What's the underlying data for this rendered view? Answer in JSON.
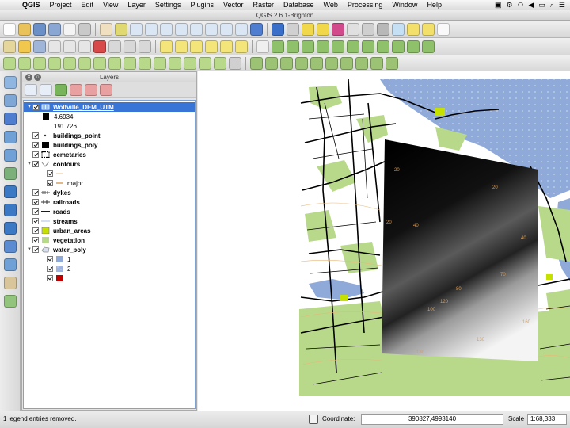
{
  "menubar": {
    "app_name": "QGIS",
    "items": [
      "Project",
      "Edit",
      "View",
      "Layer",
      "Settings",
      "Plugins",
      "Vector",
      "Raster",
      "Database",
      "Web",
      "Processing",
      "Window",
      "Help"
    ]
  },
  "window": {
    "title": "QGIS 2.6.1-Brighton"
  },
  "layers_panel": {
    "title": "Layers",
    "layers": [
      {
        "name": "Wolfville_DEM_UTM",
        "kind": "raster",
        "selected": true
      },
      {
        "name": "4.6934",
        "kind": "legend-max"
      },
      {
        "name": "191.726",
        "kind": "legend-min"
      },
      {
        "name": "buildings_point"
      },
      {
        "name": "buildings_poly"
      },
      {
        "name": "cemetaries"
      },
      {
        "name": "contours",
        "group": true
      },
      {
        "name": "",
        "kind": "sublegend"
      },
      {
        "name": "major",
        "kind": "sublegend"
      },
      {
        "name": "dykes"
      },
      {
        "name": "railroads"
      },
      {
        "name": "roads"
      },
      {
        "name": "streams"
      },
      {
        "name": "urban_areas"
      },
      {
        "name": "vegetation"
      },
      {
        "name": "water_poly",
        "group": true
      },
      {
        "name": "1",
        "kind": "sublegend"
      },
      {
        "name": "2",
        "kind": "sublegend"
      },
      {
        "name": "",
        "kind": "sublegend"
      }
    ]
  },
  "colors": {
    "selection": "#3875d7",
    "water": "#8fa9d8",
    "vegetation": "#b9d98a",
    "urban": "#c6e000",
    "dem_dark": "#000000",
    "dem_light": "#ffffff",
    "red_class": "#c00000"
  },
  "map_labels": [
    "20",
    "20",
    "20",
    "40",
    "40",
    "70",
    "80",
    "100",
    "120",
    "130",
    "130",
    "160"
  ],
  "status": {
    "message": "1 legend entries removed.",
    "coordinate_label": "Coordinate:",
    "coordinate_value": "390827,4993140",
    "scale_label": "Scale",
    "scale_value": "1:68,333"
  }
}
